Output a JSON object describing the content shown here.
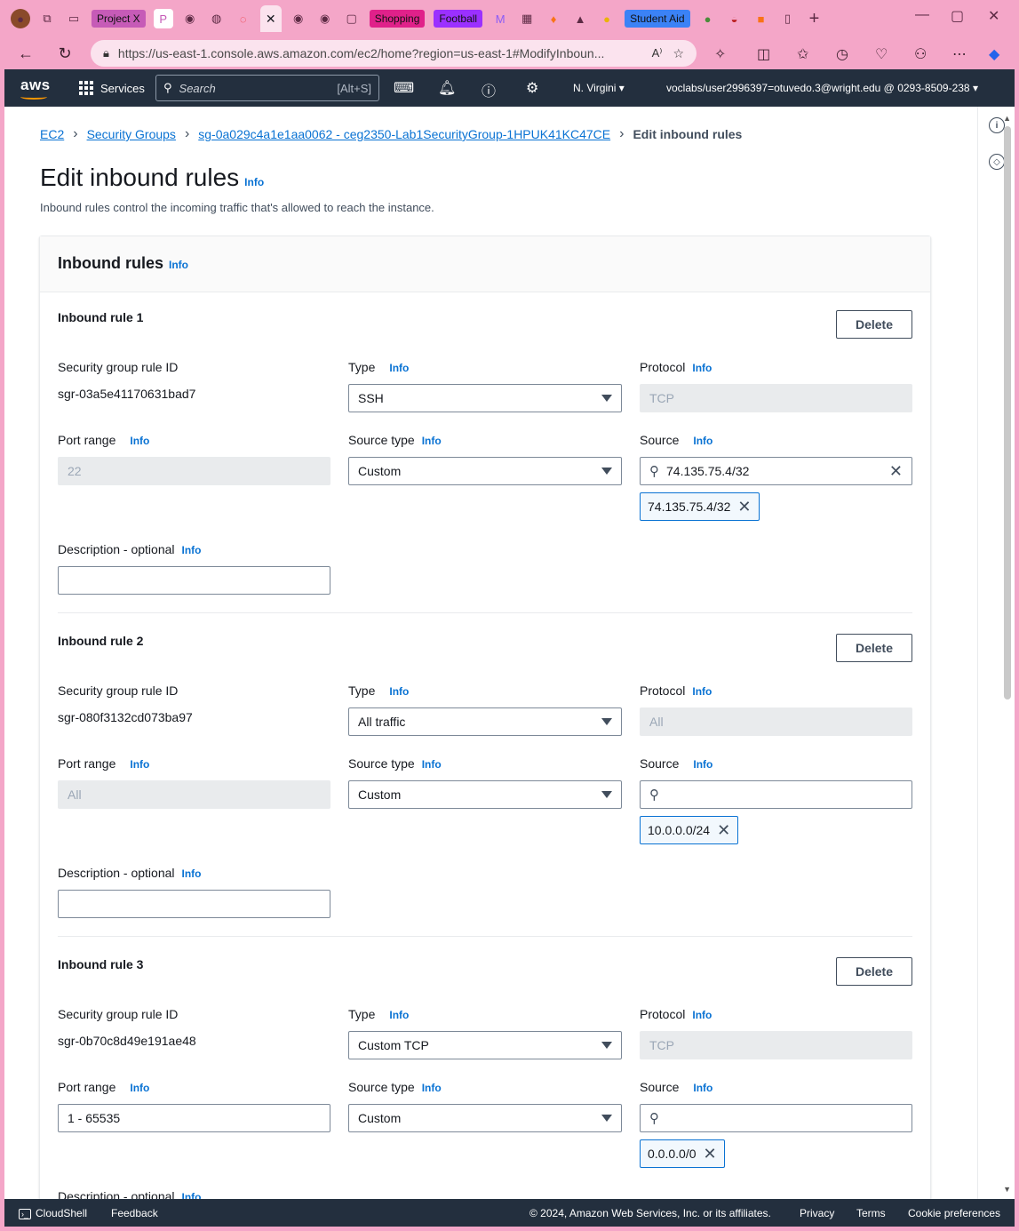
{
  "browser": {
    "tabs": [
      {
        "label": "Project X",
        "bg": "#c65bb7"
      },
      {
        "label": "Shopping",
        "bg": "#e0218a"
      },
      {
        "label": "Football",
        "bg": "#9b30ff"
      },
      {
        "label": "Student Aid",
        "bg": "#3b82f6"
      }
    ],
    "url": "https://us-east-1.console.aws.amazon.com/ec2/home?region=us-east-1#ModifyInboun..."
  },
  "aws": {
    "logo": "aws",
    "services": "Services",
    "search_placeholder": "Search",
    "search_shortcut": "[Alt+S]",
    "region": "N. Virgini",
    "account": "voclabs/user2996397=otuvedo.3@wright.edu @ 0293-8509-238"
  },
  "breadcrumb": {
    "items": [
      "EC2",
      "Security Groups",
      "sg-0a029c4a1e1aa0062 - ceg2350-Lab1SecurityGroup-1HPUK41KC47CE"
    ],
    "current": "Edit inbound rules"
  },
  "page": {
    "title": "Edit inbound rules",
    "info": "Info",
    "subtitle": "Inbound rules control the incoming traffic that's allowed to reach the instance.",
    "panel_title": "Inbound rules"
  },
  "labels": {
    "sg_rule_id": "Security group rule ID",
    "type": "Type",
    "protocol": "Protocol",
    "port_range": "Port range",
    "source_type": "Source type",
    "source": "Source",
    "description": "Description - optional",
    "delete": "Delete"
  },
  "rules": [
    {
      "title": "Inbound rule 1",
      "rule_id": "sgr-03a5e41170631bad7",
      "type": "SSH",
      "protocol": "TCP",
      "port_range": "22",
      "port_editable": false,
      "source_type": "Custom",
      "source_search": "74.135.75.4/32",
      "token": "74.135.75.4/32"
    },
    {
      "title": "Inbound rule 2",
      "rule_id": "sgr-080f3132cd073ba97",
      "type": "All traffic",
      "protocol": "All",
      "port_range": "All",
      "port_editable": false,
      "source_type": "Custom",
      "source_search": "",
      "token": "10.0.0.0/24"
    },
    {
      "title": "Inbound rule 3",
      "rule_id": "sgr-0b70c8d49e191ae48",
      "type": "Custom TCP",
      "protocol": "TCP",
      "port_range": "1 - 65535",
      "port_editable": true,
      "source_type": "Custom",
      "source_search": "",
      "token": "0.0.0.0/0"
    }
  ],
  "footer": {
    "cloudshell": "CloudShell",
    "feedback": "Feedback",
    "copyright": "© 2024, Amazon Web Services, Inc. or its affiliates.",
    "privacy": "Privacy",
    "terms": "Terms",
    "cookies": "Cookie preferences"
  }
}
